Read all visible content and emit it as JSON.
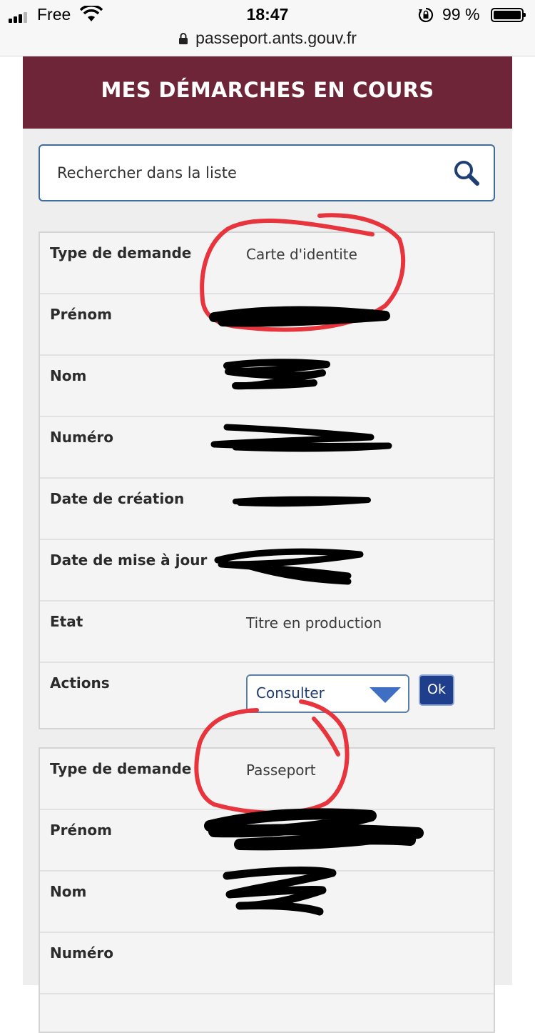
{
  "status_bar": {
    "carrier": "Free",
    "time": "18:47",
    "battery_percent": "99 %",
    "icons": [
      "signal-icon",
      "wifi-icon",
      "rotation-lock-icon",
      "battery-icon"
    ]
  },
  "browser": {
    "url": "passeport.ants.gouv.fr"
  },
  "page": {
    "banner_title": "MES DÉMARCHES EN COURS",
    "search": {
      "placeholder": "Rechercher dans la liste",
      "value": ""
    }
  },
  "requests": [
    {
      "rows": [
        {
          "label": "Type de demande",
          "value": "Carte d'identite"
        },
        {
          "label": "Prénom",
          "value": ""
        },
        {
          "label": "Nom",
          "value": ""
        },
        {
          "label": "Numéro",
          "value": ""
        },
        {
          "label": "Date de création",
          "value": ""
        },
        {
          "label": "Date de mise à jour",
          "value": ""
        },
        {
          "label": "Etat",
          "value": "Titre en production"
        },
        {
          "label": "Actions",
          "value": ""
        }
      ],
      "action_select": "Consulter",
      "ok_label": "Ok"
    },
    {
      "rows": [
        {
          "label": "Type de demande",
          "value": "Passeport"
        },
        {
          "label": "Prénom",
          "value": ""
        },
        {
          "label": "Nom",
          "value": ""
        },
        {
          "label": "Numéro",
          "value": ""
        }
      ]
    }
  ],
  "colors": {
    "banner_bg": "#6e2537",
    "search_border": "#3f6e9c",
    "ok_button": "#1f3f8c",
    "annotation_red": "#e8343c",
    "redaction": "#000000"
  }
}
